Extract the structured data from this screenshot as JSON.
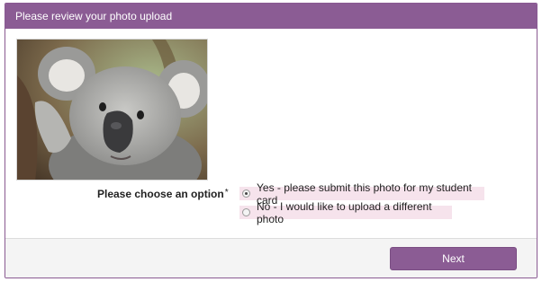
{
  "header": {
    "title": "Please review your photo upload"
  },
  "photo": {
    "subject": "koala"
  },
  "question": {
    "label": "Please choose an option",
    "required_mark": "*",
    "options": [
      {
        "label": "Yes - please submit this photo for my student card",
        "selected": true
      },
      {
        "label": "No - I would like to upload a different photo",
        "selected": false
      }
    ]
  },
  "footer": {
    "next_label": "Next"
  },
  "colors": {
    "accent": "#8b5c94",
    "option_bg": "#f6e3ec"
  }
}
